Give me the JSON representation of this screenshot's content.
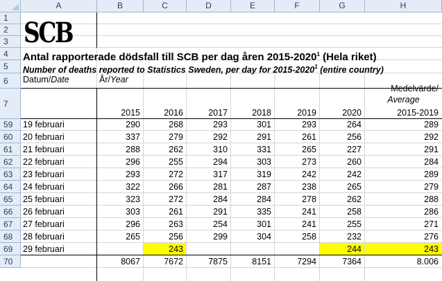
{
  "sheet": {
    "columns": [
      "A",
      "B",
      "C",
      "D",
      "E",
      "F",
      "G",
      "H"
    ],
    "rows": [
      "1",
      "2",
      "3",
      "4",
      "5",
      "6",
      "7",
      "59",
      "60",
      "61",
      "62",
      "63",
      "64",
      "65",
      "66",
      "67",
      "68",
      "69",
      "70"
    ]
  },
  "logo": "SCB",
  "title": "Antal rapporterade dödsfall till SCB per dag åren 2015-2020",
  "title_sup": "1",
  "title_suffix": " (Hela riket)",
  "subtitle": "Number of deaths reported to Statistics Sweden, per day for 2015-2020",
  "subtitle_sup": "1",
  "subtitle_suffix": "  (entire country)",
  "header": {
    "date_label_sv": "Datum/",
    "date_label_en": "Date",
    "year_label_sv": "År/",
    "year_label_en": "Year",
    "avg_label_sv": "Medelvärde/",
    "avg_label_en": "Average",
    "years": [
      "2015",
      "2016",
      "2017",
      "2018",
      "2019",
      "2020",
      "2015-2019"
    ]
  },
  "table": [
    {
      "date": "19 februari",
      "values": [
        "290",
        "268",
        "293",
        "301",
        "293",
        "264",
        "289"
      ],
      "highlight": [
        false,
        false,
        false,
        false,
        false,
        false,
        false
      ]
    },
    {
      "date": "20 februari",
      "values": [
        "337",
        "279",
        "292",
        "291",
        "261",
        "256",
        "292"
      ],
      "highlight": [
        false,
        false,
        false,
        false,
        false,
        false,
        false
      ]
    },
    {
      "date": "21 februari",
      "values": [
        "288",
        "262",
        "310",
        "331",
        "265",
        "227",
        "291"
      ],
      "highlight": [
        false,
        false,
        false,
        false,
        false,
        false,
        false
      ]
    },
    {
      "date": "22 februari",
      "values": [
        "296",
        "255",
        "294",
        "303",
        "273",
        "260",
        "284"
      ],
      "highlight": [
        false,
        false,
        false,
        false,
        false,
        false,
        false
      ]
    },
    {
      "date": "23 februari",
      "values": [
        "293",
        "272",
        "317",
        "319",
        "242",
        "242",
        "289"
      ],
      "highlight": [
        false,
        false,
        false,
        false,
        false,
        false,
        false
      ]
    },
    {
      "date": "24 februari",
      "values": [
        "322",
        "266",
        "281",
        "287",
        "238",
        "265",
        "279"
      ],
      "highlight": [
        false,
        false,
        false,
        false,
        false,
        false,
        false
      ]
    },
    {
      "date": "25 februari",
      "values": [
        "323",
        "272",
        "284",
        "284",
        "278",
        "262",
        "288"
      ],
      "highlight": [
        false,
        false,
        false,
        false,
        false,
        false,
        false
      ]
    },
    {
      "date": "26 februari",
      "values": [
        "303",
        "261",
        "291",
        "335",
        "241",
        "258",
        "286"
      ],
      "highlight": [
        false,
        false,
        false,
        false,
        false,
        false,
        false
      ]
    },
    {
      "date": "27 februari",
      "values": [
        "296",
        "263",
        "254",
        "301",
        "241",
        "255",
        "271"
      ],
      "highlight": [
        false,
        false,
        false,
        false,
        false,
        false,
        false
      ]
    },
    {
      "date": "28 februari",
      "values": [
        "265",
        "256",
        "299",
        "304",
        "258",
        "232",
        "276"
      ],
      "highlight": [
        false,
        false,
        false,
        false,
        false,
        false,
        false
      ]
    },
    {
      "date": "29 februari",
      "values": [
        "",
        "243",
        "",
        "",
        "",
        "244",
        "243"
      ],
      "highlight": [
        false,
        true,
        false,
        false,
        false,
        true,
        true
      ]
    },
    {
      "date": "",
      "values": [
        "8067",
        "7672",
        "7875",
        "8151",
        "7294",
        "7364",
        "8.006"
      ],
      "highlight": [
        false,
        false,
        false,
        false,
        false,
        false,
        false
      ]
    }
  ],
  "colors": {
    "highlight": "#ffff00",
    "header_bg": "#e4ecf7",
    "header_text": "#27415f",
    "grid": "#d4d4d4"
  }
}
